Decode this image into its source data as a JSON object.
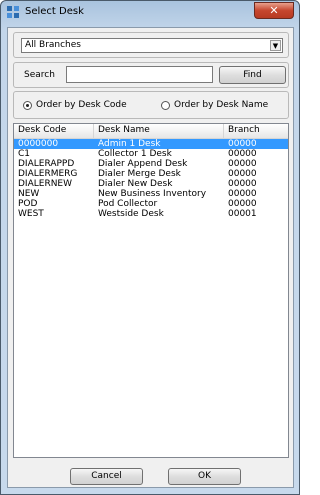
{
  "window": {
    "title": "Select Desk",
    "close_glyph": "✕"
  },
  "branch": {
    "selected": "All Branches"
  },
  "search": {
    "label": "Search",
    "value": "",
    "find_label": "Find"
  },
  "order": {
    "by_code_label": "Order by Desk Code",
    "by_name_label": "Order by Desk Name",
    "selected": "by_code"
  },
  "table": {
    "columns": [
      "Desk Code",
      "Desk Name",
      "Branch"
    ],
    "rows": [
      {
        "code": "0000000",
        "name": "Admin 1 Desk",
        "branch": "00000",
        "selected": true
      },
      {
        "code": "C1",
        "name": "Collector 1 Desk",
        "branch": "00000",
        "selected": false
      },
      {
        "code": "DIALERAPPD",
        "name": "Dialer Append Desk",
        "branch": "00000",
        "selected": false
      },
      {
        "code": "DIALERMERG",
        "name": "Dialer Merge Desk",
        "branch": "00000",
        "selected": false
      },
      {
        "code": "DIALERNEW",
        "name": "Dialer New Desk",
        "branch": "00000",
        "selected": false
      },
      {
        "code": "NEW",
        "name": "New Business Inventory",
        "branch": "00000",
        "selected": false
      },
      {
        "code": "POD",
        "name": "Pod Collector",
        "branch": "00000",
        "selected": false
      },
      {
        "code": "WEST",
        "name": "Westside Desk",
        "branch": "00001",
        "selected": false
      }
    ]
  },
  "buttons": {
    "cancel": "Cancel",
    "ok": "OK"
  },
  "colors": {
    "selection": "#3399ff",
    "close_button": "#c6462e"
  }
}
